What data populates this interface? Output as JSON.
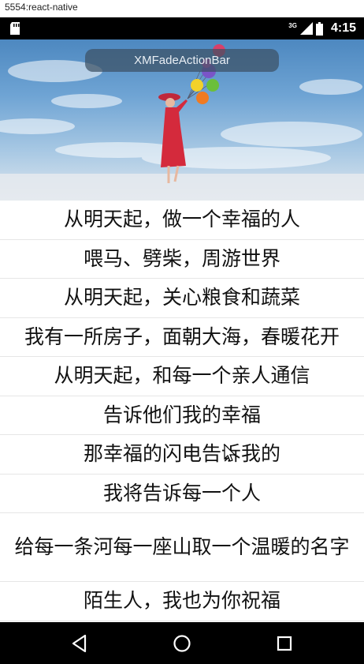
{
  "window": {
    "title": "5554:react-native"
  },
  "status_bar": {
    "network_label": "3G",
    "clock": "4:15",
    "icons": [
      "sd-card-icon",
      "signal-icon",
      "battery-icon"
    ]
  },
  "action_bar": {
    "title": "XMFadeActionBar"
  },
  "poem": {
    "lines": [
      "从明天起，做一个幸福的人",
      "喂马、劈柴，周游世界",
      "从明天起，关心粮食和蔬菜",
      "我有一所房子，面朝大海，春暖花开",
      "从明天起，和每一个亲人通信",
      "告诉他们我的幸福",
      "那幸福的闪电告诉我的",
      "我将告诉每一个人",
      "给每一条河每一座山取一个温暖的名字",
      "陌生人，我也为你祝福"
    ]
  },
  "nav_bar": {
    "icons": [
      "back-icon",
      "home-icon",
      "recents-icon"
    ]
  }
}
